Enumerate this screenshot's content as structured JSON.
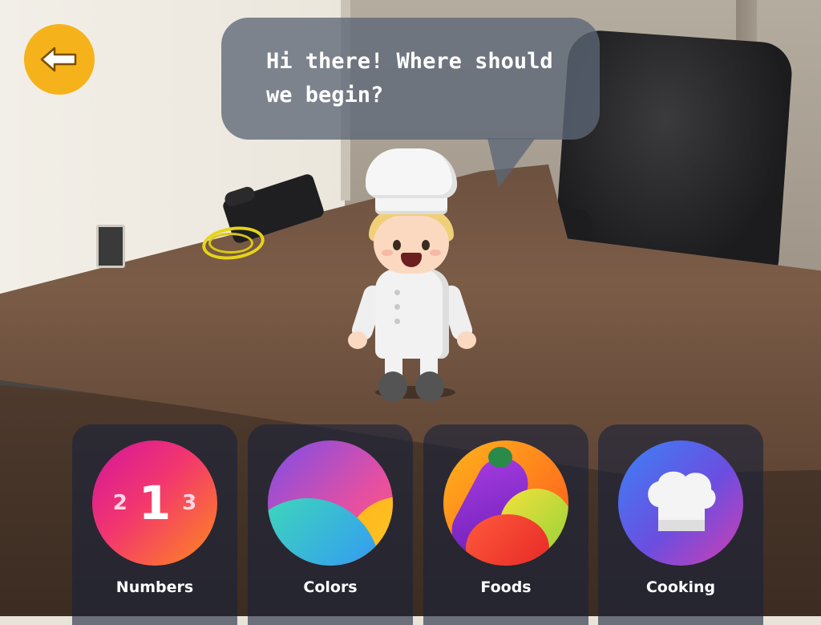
{
  "bubble": {
    "text": "Hi there! Where should we begin?"
  },
  "back_button": {
    "icon": "arrow-left-icon",
    "color": "#f6b21a"
  },
  "categories": [
    {
      "label": "Numbers",
      "icon": "numbers-icon",
      "digits": {
        "left": "2",
        "center": "1",
        "right": "3"
      }
    },
    {
      "label": "Colors",
      "icon": "color-blobs-icon"
    },
    {
      "label": "Foods",
      "icon": "vegetables-icon"
    },
    {
      "label": "Cooking",
      "icon": "chef-hat-icon"
    }
  ],
  "colors": {
    "accent": "#f6b21a",
    "tile_background": "rgba(24,34,58,0.6)",
    "bubble_background": "rgba(92,102,118,0.78)"
  }
}
